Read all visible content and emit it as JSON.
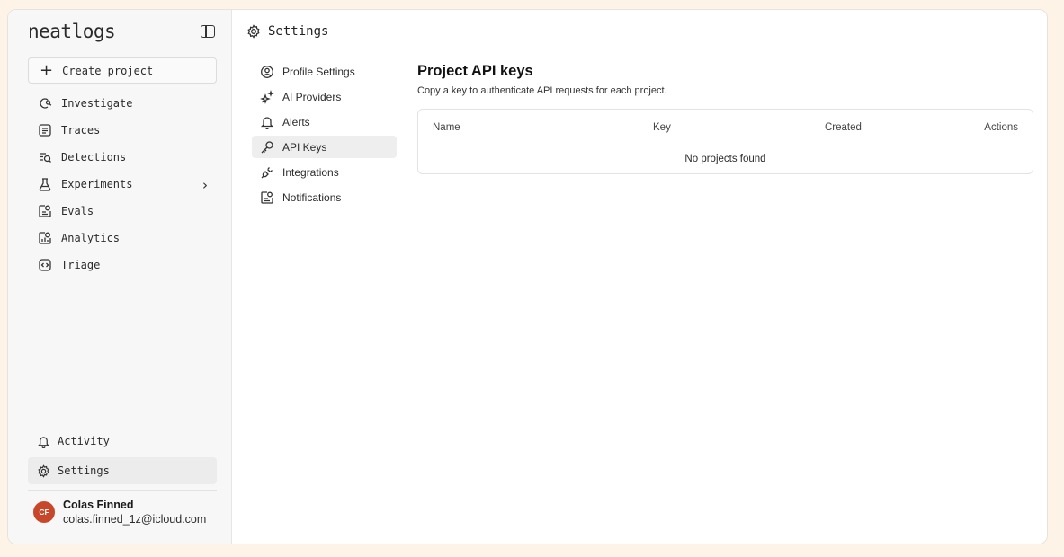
{
  "brand": "neatlogs",
  "sidebar": {
    "create_label": "Create project",
    "items": [
      {
        "label": "Investigate",
        "icon": "investigate-icon"
      },
      {
        "label": "Traces",
        "icon": "traces-icon"
      },
      {
        "label": "Detections",
        "icon": "detections-icon"
      },
      {
        "label": "Experiments",
        "icon": "experiments-icon"
      },
      {
        "label": "Evals",
        "icon": "evals-icon"
      },
      {
        "label": "Analytics",
        "icon": "analytics-icon"
      },
      {
        "label": "Triage",
        "icon": "triage-icon"
      }
    ],
    "bottom": [
      {
        "label": "Activity",
        "icon": "bell-icon"
      },
      {
        "label": "Settings",
        "icon": "gear-icon"
      }
    ],
    "user": {
      "initials": "CF",
      "name": "Colas Finned",
      "email": "colas.finned_1z@icloud.com",
      "avatar_color": "#c8462a"
    }
  },
  "page": {
    "title": "Settings"
  },
  "submenu": [
    {
      "label": "Profile Settings",
      "icon": "user-circle-icon"
    },
    {
      "label": "AI Providers",
      "icon": "sparkles-icon"
    },
    {
      "label": "Alerts",
      "icon": "bell-icon"
    },
    {
      "label": "API Keys",
      "icon": "key-icon",
      "active": true
    },
    {
      "label": "Integrations",
      "icon": "plug-icon"
    },
    {
      "label": "Notifications",
      "icon": "notifications-icon"
    }
  ],
  "api_keys": {
    "heading": "Project API keys",
    "description": "Copy a key to authenticate API requests for each project.",
    "columns": [
      "Name",
      "Key",
      "Created",
      "Actions"
    ],
    "empty": "No projects found"
  }
}
